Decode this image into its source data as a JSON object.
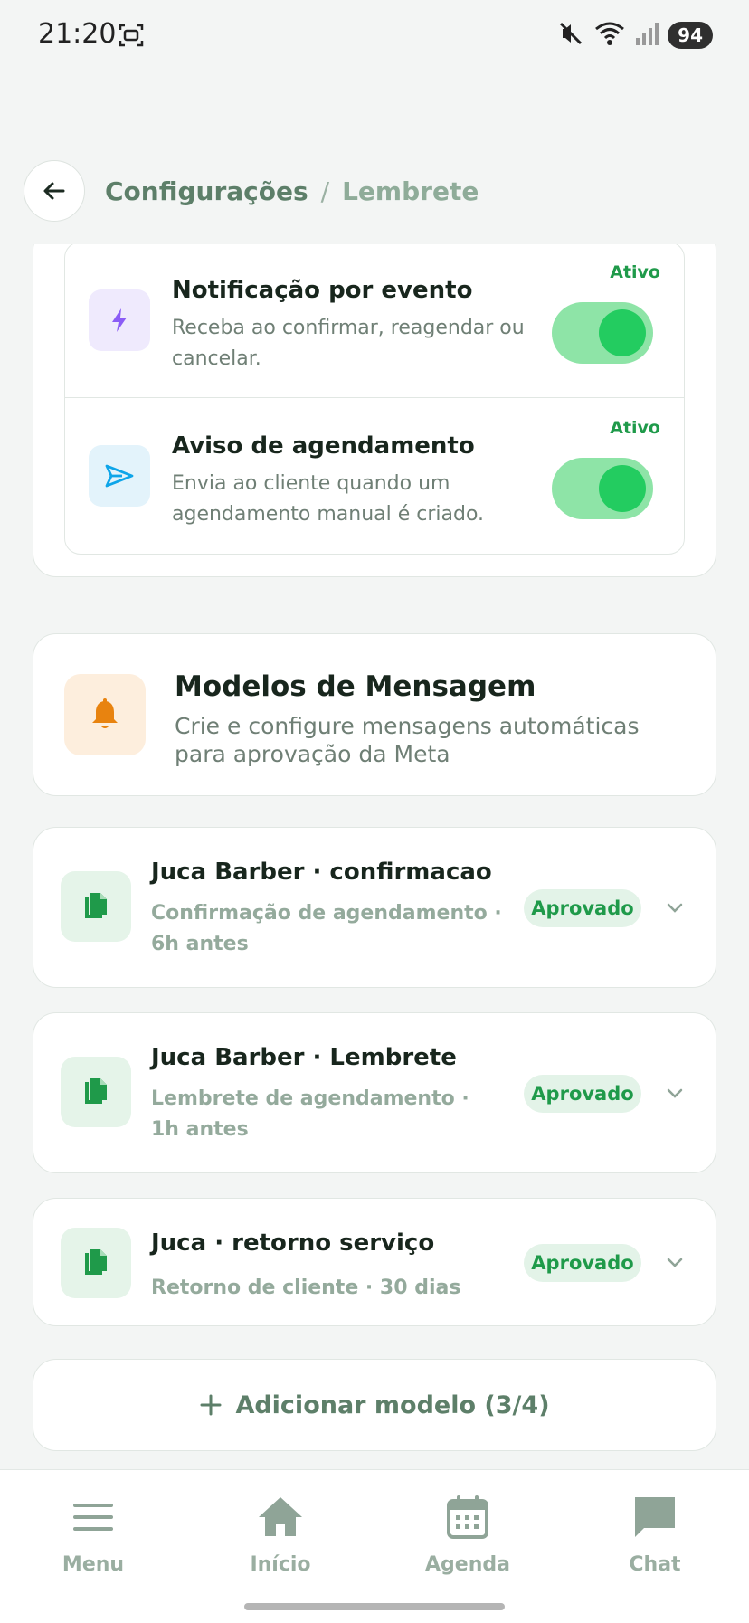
{
  "status_bar": {
    "time": "21:20",
    "battery": "94",
    "icons": [
      "screenshot-icon",
      "mute-icon",
      "wifi-icon",
      "signal-icon"
    ]
  },
  "header": {
    "breadcrumb_parent": "Configurações",
    "breadcrumb_separator": "/",
    "breadcrumb_current": "Lembrete"
  },
  "settings": [
    {
      "title": "Notificação por evento",
      "description": "Receba ao confirmar, reagendar ou cancelar.",
      "status": "Ativo",
      "enabled": true,
      "icon": "lightning-icon",
      "icon_color": "#8b5cf6"
    },
    {
      "title": "Aviso de agendamento",
      "description": "Envia ao cliente quando um agendamento manual é criado.",
      "status": "Ativo",
      "enabled": true,
      "icon": "send-icon",
      "icon_color": "#0ea5e9"
    }
  ],
  "templates_section": {
    "title": "Modelos de Mensagem",
    "subtitle": "Crie e configure mensagens automáticas para aprovação da Meta",
    "icon": "bell-icon",
    "icon_color": "#e8830f"
  },
  "templates": [
    {
      "title": "Juca Barber · confirmacao",
      "meta": "Confirmação de agendamento · 6h antes",
      "status": "Aprovado"
    },
    {
      "title": "Juca Barber · Lembrete",
      "meta": "Lembrete de agendamento · 1h antes",
      "status": "Aprovado"
    },
    {
      "title": "Juca · retorno serviço",
      "meta": "Retorno de cliente · 30 dias",
      "status": "Aprovado"
    }
  ],
  "add_button": {
    "label": "Adicionar modelo (3/4)"
  },
  "bottom_nav": [
    {
      "label": "Menu",
      "icon": "menu-icon"
    },
    {
      "label": "Início",
      "icon": "home-icon"
    },
    {
      "label": "Agenda",
      "icon": "calendar-icon"
    },
    {
      "label": "Chat",
      "icon": "chat-icon"
    }
  ],
  "colors": {
    "accent_green": "#23cc60",
    "status_green": "#1f9a4a",
    "breadcrumb_green": "#5d7f69"
  }
}
